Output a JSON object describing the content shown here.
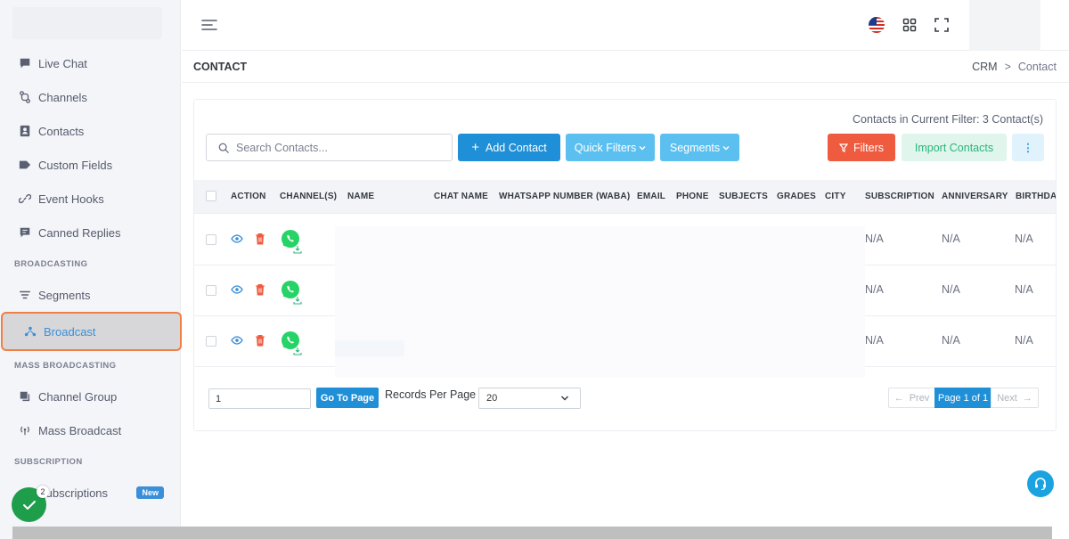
{
  "sidebar": {
    "items_top": [
      {
        "label": "Live Chat",
        "icon": "chat-icon"
      },
      {
        "label": "Channels",
        "icon": "channels-icon"
      },
      {
        "label": "Contacts",
        "icon": "contacts-icon"
      },
      {
        "label": "Custom Fields",
        "icon": "tag-icon"
      },
      {
        "label": "Event Hooks",
        "icon": "link-icon"
      },
      {
        "label": "Canned Replies",
        "icon": "message-icon"
      }
    ],
    "section_broadcasting": "BROADCASTING",
    "segments": "Segments",
    "broadcast": "Broadcast",
    "section_mass": "MASS BROADCASTING",
    "channel_group": "Channel Group",
    "mass_broadcast": "Mass Broadcast",
    "section_subscription": "SUBSCRIPTION",
    "subscriptions": "Subscriptions",
    "new_badge": "New",
    "fab_count": "2"
  },
  "header": {
    "page_title": "CONTACT",
    "breadcrumb_root": "CRM",
    "breadcrumb_sep": ">",
    "breadcrumb_current": "Contact"
  },
  "toolbar": {
    "filter_count": "Contacts in Current Filter: 3 Contact(s)",
    "search_placeholder": "Search Contacts...",
    "add_contact": "Add Contact",
    "quick_filters": "Quick Filters",
    "segments": "Segments",
    "filters": "Filters",
    "import_contacts": "Import Contacts",
    "more": "⋮"
  },
  "table": {
    "columns": [
      "ACTION",
      "CHANNEL(S)",
      "NAME",
      "CHAT NAME",
      "WHATSAPP NUMBER (WABA)",
      "EMAIL",
      "PHONE",
      "SUBJECTS",
      "GRADES",
      "CITY",
      "SUBSCRIPTION",
      "ANNIVERSARY",
      "BIRTHDAY"
    ],
    "rows": [
      {
        "subscription": "N/A",
        "anniversary": "N/A",
        "birthday": "N/A"
      },
      {
        "subscription": "N/A",
        "anniversary": "N/A",
        "birthday": "N/A"
      },
      {
        "subscription": "N/A",
        "anniversary": "N/A",
        "birthday": "N/A"
      }
    ]
  },
  "pagination": {
    "page_input": "1",
    "go_to_page": "Go To Page",
    "records_per_page_label": "Records Per Page",
    "records_per_page": "20",
    "prev": "Prev",
    "current": "Page 1 of 1",
    "next": "Next"
  },
  "colors": {
    "primary": "#1f8fd7",
    "info": "#5bc0f0",
    "danger": "#ef5b3f",
    "success": "#2ab57d",
    "whatsapp": "#25d366"
  }
}
